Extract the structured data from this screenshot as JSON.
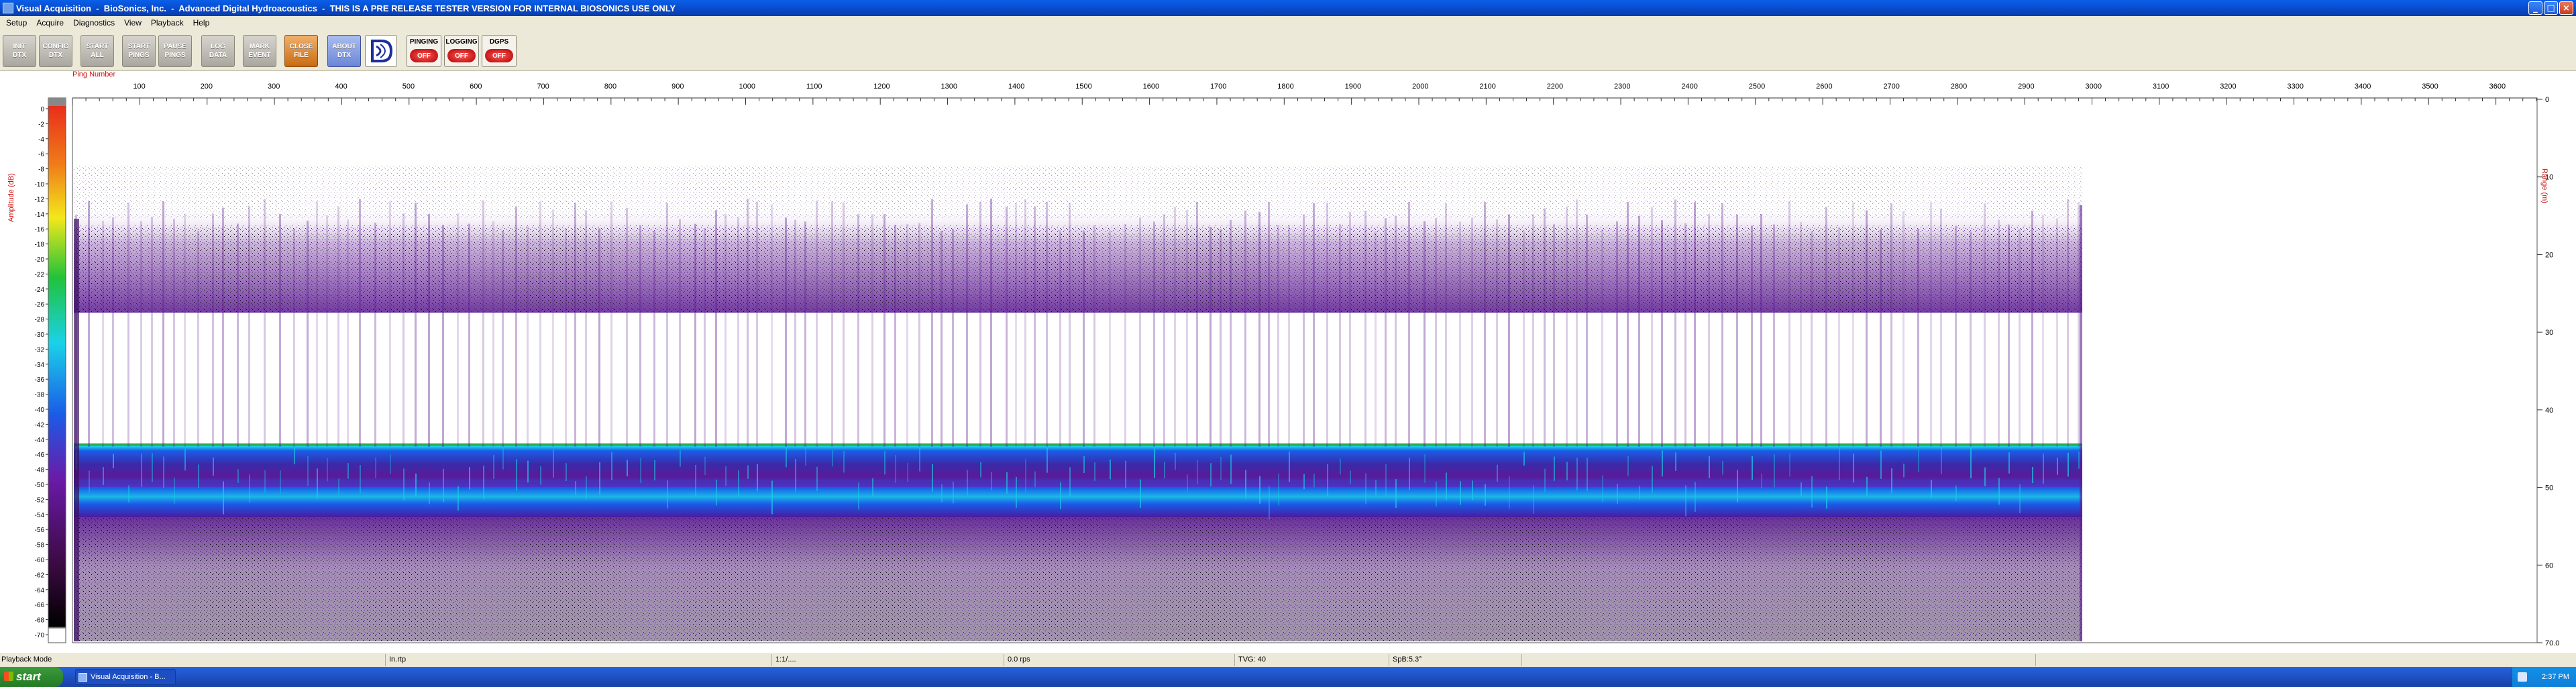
{
  "window": {
    "title": "Visual Acquisition  -  BioSonics, Inc.  -  Advanced Digital Hydroacoustics  -  THIS IS A PRE RELEASE TESTER VERSION FOR INTERNAL BIOSONICS USE ONLY",
    "buttons": {
      "minimize": "_",
      "maximize": "□",
      "close": "×"
    }
  },
  "menu": [
    "Setup",
    "Acquire",
    "Diagnostics",
    "View",
    "Playback",
    "Help"
  ],
  "toolbar": {
    "buttons": [
      "INIT\nDTX",
      "CONFIG\nDTX",
      "START\nALL",
      "START\nPINGS",
      "PAUSE\nPINGS",
      "LOG\nDATA",
      "MARK\nEVENT",
      "CLOSE\nFILE",
      "ABOUT\nDTX"
    ],
    "indicators": [
      {
        "label": "PINGING",
        "state": "OFF"
      },
      {
        "label": "LOGGING",
        "state": "OFF"
      },
      {
        "label": "DGPS",
        "state": "OFF"
      }
    ]
  },
  "echogram": {
    "top_axis_label": "Ping Number",
    "left_axis_label": "Amplitude (dB)",
    "right_axis_label": "Range (m)",
    "ping_ticks": [
      "100",
      "200",
      "300",
      "400",
      "500",
      "600",
      "700",
      "800",
      "900",
      "1000",
      "1100",
      "1200",
      "1300",
      "1400",
      "1500",
      "1600",
      "1700",
      "1800",
      "1900",
      "2000",
      "2100",
      "2200",
      "2300",
      "2400",
      "2500",
      "2600",
      "2700",
      "2800",
      "2900",
      "3000",
      "3100",
      "3200",
      "3300",
      "3400",
      "3500",
      "3600"
    ],
    "amplitude_ticks": [
      "0",
      "-2",
      "-4",
      "-6",
      "-8",
      "-10",
      "-12",
      "-14",
      "-16",
      "-18",
      "-20",
      "-22",
      "-24",
      "-26",
      "-28",
      "-30",
      "-32",
      "-34",
      "-36",
      "-38",
      "-40",
      "-42",
      "-44",
      "-46",
      "-48",
      "-50",
      "-52",
      "-54",
      "-56",
      "-58",
      "-60",
      "-62",
      "-64",
      "-66",
      "-68",
      "-70"
    ],
    "range_ticks": [
      "0",
      "10",
      "20",
      "30",
      "40",
      "50",
      "60",
      "70.0"
    ],
    "colors": {
      "red": "#e8241a",
      "orange": "#f59a1a",
      "yellow": "#f2e81a",
      "green": "#21c23a",
      "cyan": "#1ad2e8",
      "blue": "#1a5ce8",
      "purple": "#6a1aa8",
      "black": "#000000",
      "label_red": "#d01010"
    }
  },
  "status": {
    "mode": "Playback Mode",
    "field2": "In.rtp",
    "field3": "1:1/....",
    "field4": "0.0 rps",
    "field5": "TVG: 40",
    "field6": "SpB:5.3°"
  },
  "taskbar": {
    "start": "start",
    "task": "Visual Acquisition  -  B...",
    "clock": "2:37 PM"
  }
}
